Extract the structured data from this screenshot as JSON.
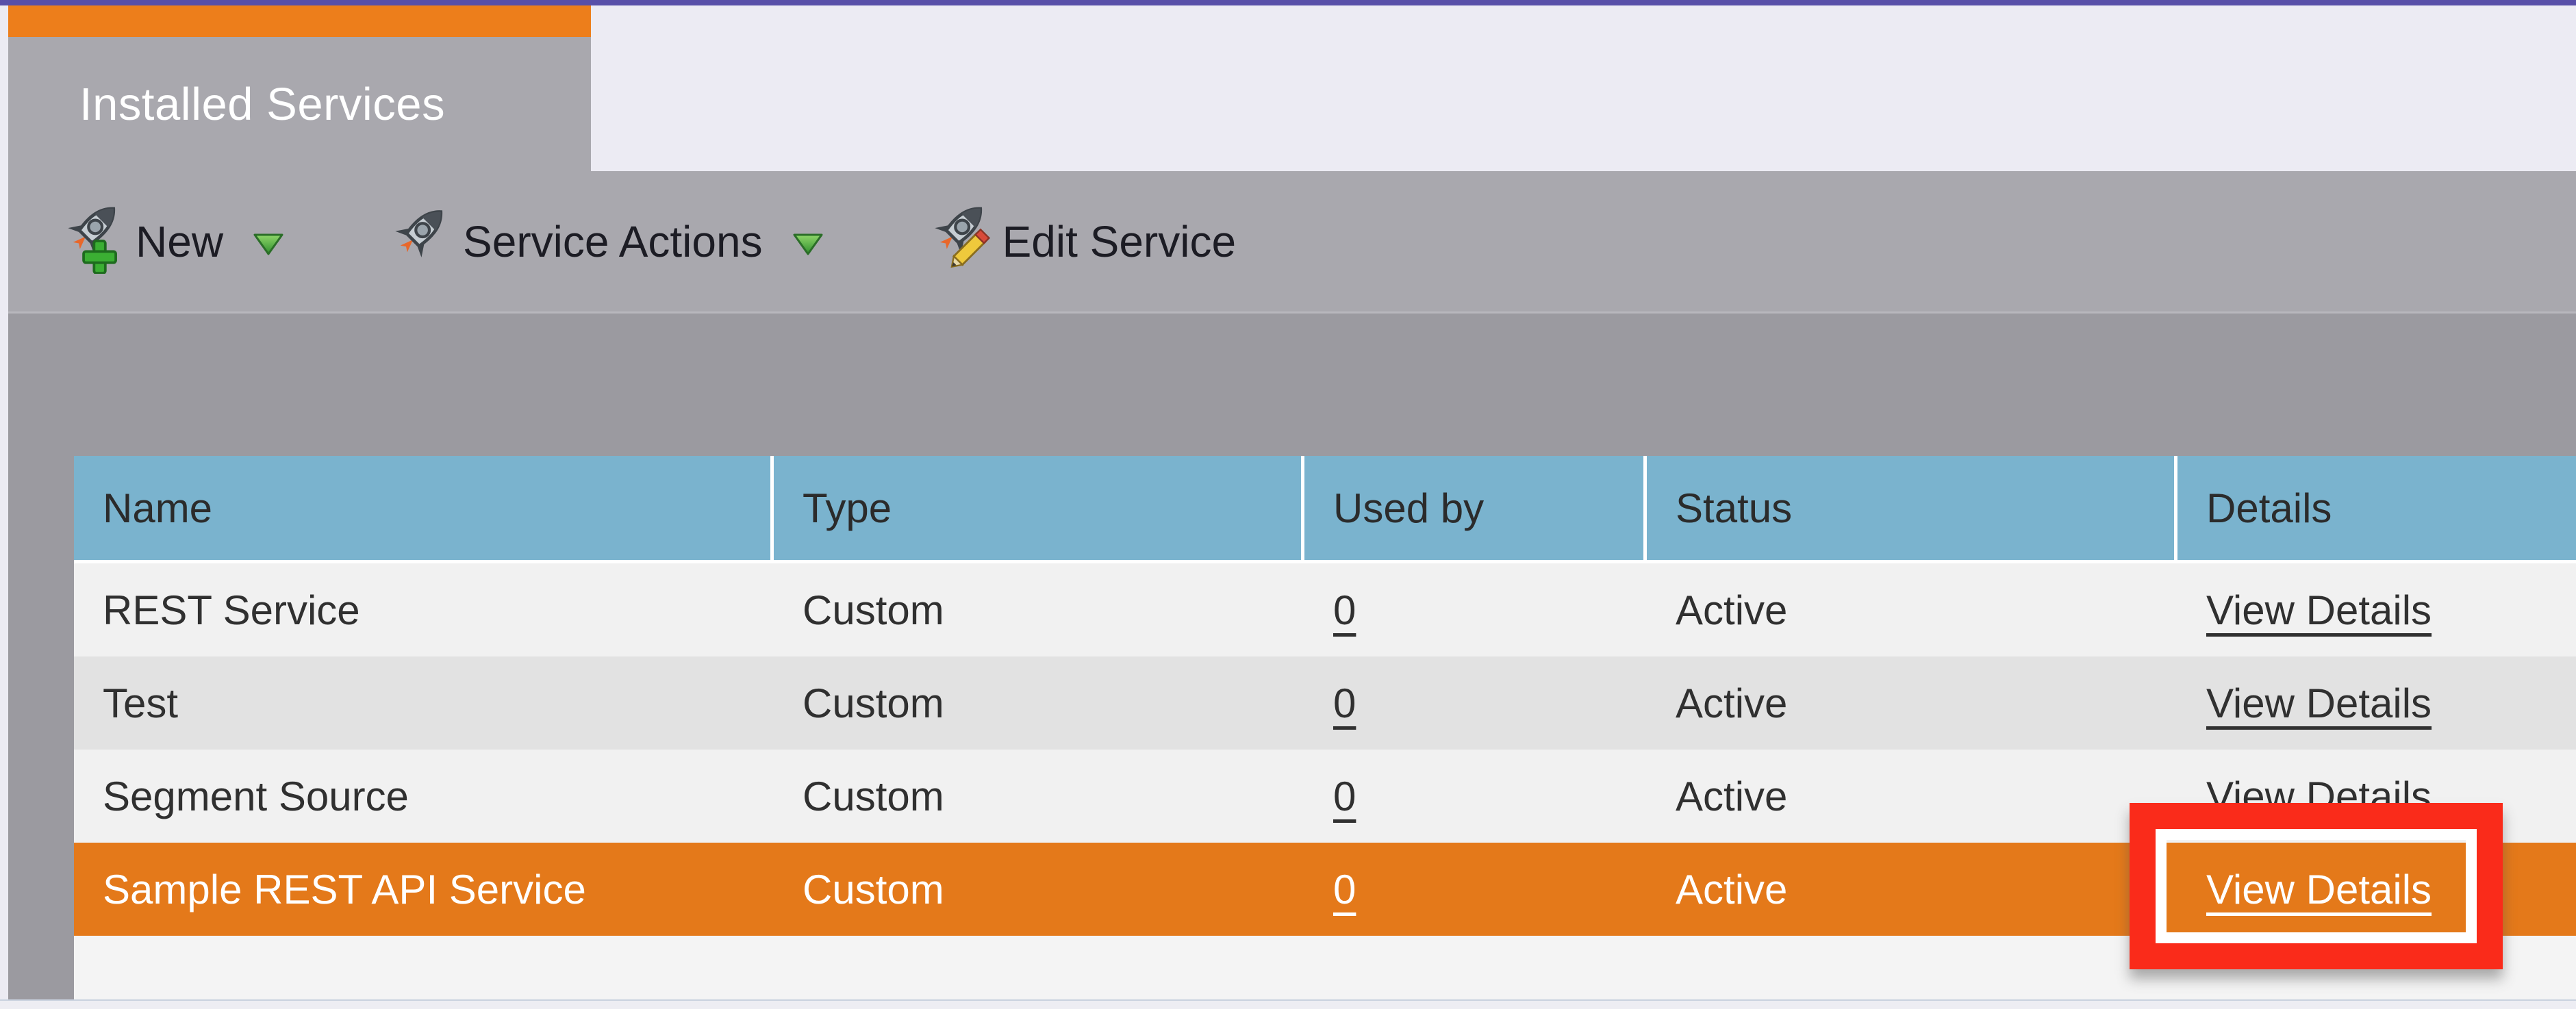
{
  "window": {
    "top_accent_color": "#584FA8",
    "background_color": "#ECEBF3"
  },
  "tab": {
    "label": "Installed Services",
    "accent_color": "#ED7E1B",
    "body_color": "#A9A8AE"
  },
  "toolbar": {
    "background_color": "#A9A8AE",
    "buttons": [
      {
        "label": "New",
        "icon": "rocket-plus-icon",
        "has_dropdown": true
      },
      {
        "label": "Service Actions",
        "icon": "rocket-icon",
        "has_dropdown": true
      },
      {
        "label": "Edit Service",
        "icon": "rocket-pencil-icon",
        "has_dropdown": false
      }
    ]
  },
  "table": {
    "header_color": "#7AB3CE",
    "columns": [
      "Name",
      "Type",
      "Used by",
      "Status",
      "Details"
    ],
    "rows": [
      {
        "name": "REST Service",
        "type": "Custom",
        "used_by": "0",
        "status": "Active",
        "details": "View Details",
        "selected": false
      },
      {
        "name": "Test",
        "type": "Custom",
        "used_by": "0",
        "status": "Active",
        "details": "View Details",
        "selected": false
      },
      {
        "name": "Segment Source",
        "type": "Custom",
        "used_by": "0",
        "status": "Active",
        "details": "View Details",
        "selected": false
      },
      {
        "name": "Sample REST API Service",
        "type": "Custom",
        "used_by": "0",
        "status": "Active",
        "details": "View Details",
        "selected": true
      }
    ],
    "selected_row_color": "#E4791A"
  },
  "annotation": {
    "type": "highlight-box",
    "color": "#FA2B1A",
    "target": "View Details link of selected row"
  }
}
